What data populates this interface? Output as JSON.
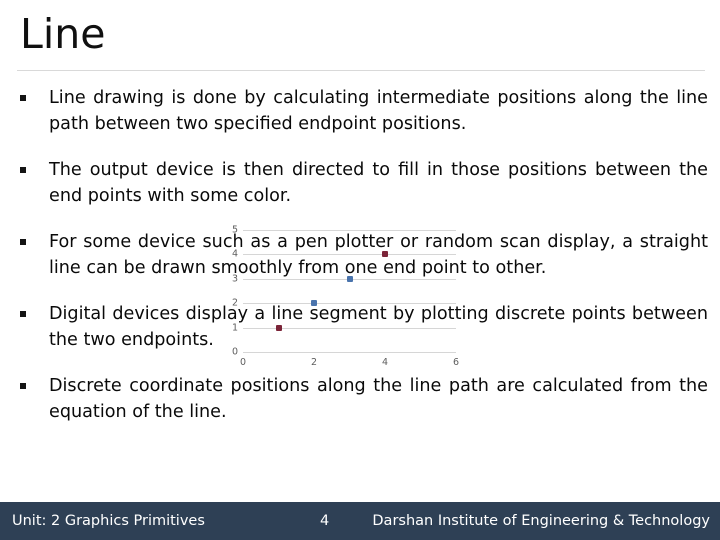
{
  "slide": {
    "title": "Line"
  },
  "bullets": [
    {
      "text": "Line drawing is done by calculating intermediate positions along the line path between two specified endpoint positions."
    },
    {
      "text": "The output device is then directed to fill in those positions between the end points with some color."
    },
    {
      "text": "For some device such as a pen plotter or random scan display, a straight line can be drawn smoothly from one end point to other."
    },
    {
      "text": "Digital devices display a line segment by plotting discrete points between the two endpoints."
    },
    {
      "text": "Discrete coordinate positions along the line path are calculated from the equation of the line."
    }
  ],
  "chart_data": {
    "type": "scatter",
    "title": "",
    "xlabel": "",
    "ylabel": "",
    "xlim": [
      0,
      6
    ],
    "ylim": [
      0,
      5
    ],
    "xticks": [
      "0",
      "2",
      "4",
      "6"
    ],
    "xtick_values": [
      0,
      2,
      4,
      6
    ],
    "yticks": [
      "0",
      "1",
      "2",
      "3",
      "4",
      "5"
    ],
    "ytick_values": [
      0,
      1,
      2,
      3,
      4,
      5
    ],
    "grid": "horizontal",
    "legend": "none",
    "colors": {
      "maroon": "#7b2438",
      "blue": "#4a74ad",
      "gridline": "#d6d6d6",
      "tick_text": "#5e5e5e"
    },
    "points": [
      {
        "x": 1,
        "y": 1,
        "color": "#7b2438"
      },
      {
        "x": 2,
        "y": 2,
        "color": "#4a74ad"
      },
      {
        "x": 3,
        "y": 3,
        "color": "#4a74ad"
      },
      {
        "x": 4,
        "y": 4,
        "color": "#7b2438"
      }
    ]
  },
  "footer": {
    "unit": "Unit: 2 Graphics Primitives",
    "page": "4",
    "institute": "Darshan Institute of Engineering & Technology",
    "background": "#2e4055",
    "text_color": "#ffffff"
  }
}
